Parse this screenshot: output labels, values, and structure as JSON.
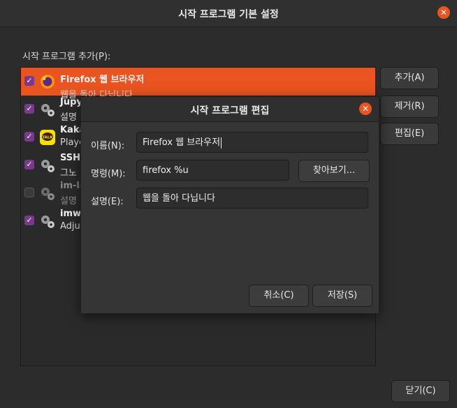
{
  "window": {
    "title": "시작 프로그램 기본 설정",
    "close_symbol": "✕"
  },
  "section_label": "시작 프로그램 추가(P):",
  "items": [
    {
      "name": "Firefox 웹 브라우저",
      "desc": "웹을 돌아 다닙니다",
      "checked": true,
      "icon": "firefox-icon"
    },
    {
      "name": "Jupy",
      "desc": "설명",
      "checked": true,
      "icon": "gears-icon"
    },
    {
      "name": "Kaka",
      "desc": "Playe",
      "checked": true,
      "icon": "kakaotalk-icon"
    },
    {
      "name": "SSH",
      "desc": "그노",
      "checked": true,
      "icon": "gears-icon"
    },
    {
      "name": "im-la",
      "desc": "설명",
      "checked": false,
      "icon": "gears-icon"
    },
    {
      "name": "imwh",
      "desc": "Adju",
      "checked": true,
      "icon": "gears-icon"
    }
  ],
  "kakao_badge": "TALK",
  "buttons": {
    "add": "추가(A)",
    "remove": "제거(R)",
    "edit": "편집(E)",
    "close": "닫기(C)"
  },
  "dialog": {
    "title": "시작 프로그램 편집",
    "name_label": "이름(N):",
    "name_value": "Firefox 웹 브라우저",
    "command_label": "명령(M):",
    "command_value": "firefox %u",
    "browse_button": "찾아보기...",
    "comment_label": "설명(E):",
    "comment_value": "웹을 돌아 다닙니다",
    "cancel_button": "취소(C)",
    "save_button": "저장(S)"
  },
  "colors": {
    "accent": "#e95420",
    "checkbox": "#7a3a8c",
    "background": "#2c2c2c"
  }
}
